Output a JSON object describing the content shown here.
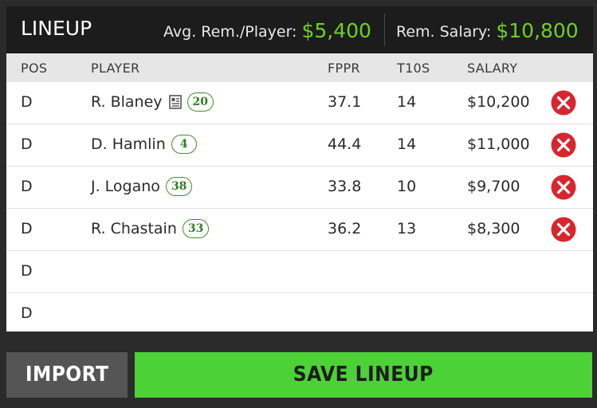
{
  "header": {
    "title": "LINEUP",
    "avg_label": "Avg. Rem./Player:",
    "avg_value": "$5,400",
    "rem_label": "Rem. Salary:",
    "rem_value": "$10,800"
  },
  "columns": {
    "pos": "POS",
    "player": "PLAYER",
    "fppr": "FPPR",
    "t10s": "T10S",
    "salary": "SALARY"
  },
  "rows": [
    {
      "pos": "D",
      "player": "R. Blaney",
      "number": "20",
      "has_news": true,
      "fppr": "37.1",
      "t10s": "14",
      "salary": "$10,200",
      "removable": true
    },
    {
      "pos": "D",
      "player": "D. Hamlin",
      "number": "4",
      "has_news": false,
      "fppr": "44.4",
      "t10s": "14",
      "salary": "$11,000",
      "removable": true
    },
    {
      "pos": "D",
      "player": "J. Logano",
      "number": "38",
      "has_news": false,
      "fppr": "33.8",
      "t10s": "10",
      "salary": "$9,700",
      "removable": true
    },
    {
      "pos": "D",
      "player": "R. Chastain",
      "number": "33",
      "has_news": false,
      "fppr": "36.2",
      "t10s": "13",
      "salary": "$8,300",
      "removable": true
    },
    {
      "pos": "D",
      "player": "",
      "number": "",
      "has_news": false,
      "fppr": "",
      "t10s": "",
      "salary": "",
      "removable": false
    },
    {
      "pos": "D",
      "player": "",
      "number": "",
      "has_news": false,
      "fppr": "",
      "t10s": "",
      "salary": "",
      "removable": false
    }
  ],
  "buttons": {
    "import": "IMPORT",
    "save": "SAVE LINEUP"
  },
  "colors": {
    "accent_green": "#6fcf2a",
    "save_button": "#4cd137",
    "remove_red": "#d8262f",
    "badge_green": "#2e7d1e"
  },
  "icons": {
    "remove": "remove-x-circle-icon",
    "news": "news-document-icon"
  }
}
